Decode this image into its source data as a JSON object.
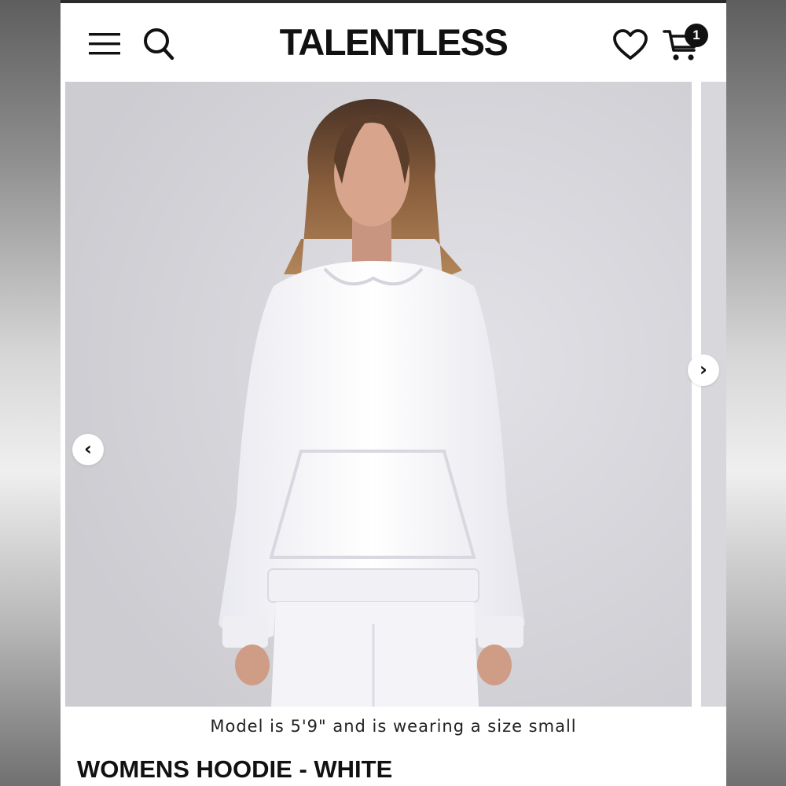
{
  "header": {
    "brand": "TALENTLESS",
    "menu_icon": "hamburger-menu-icon",
    "search_icon": "search-icon",
    "wishlist_icon": "heart-icon",
    "cart_icon": "cart-icon",
    "cart_count": "1"
  },
  "gallery": {
    "prev_symbol": "‹",
    "next_symbol": "›",
    "zoom_icon": "magnifier-icon",
    "image_subject": "model wearing white hoodie"
  },
  "product": {
    "model_caption": "Model is 5'9\" and is wearing a size small",
    "title": "WOMENS HOODIE - WHITE"
  },
  "colors": {
    "brand_text": "#111111",
    "background": "#ffffff",
    "photo_backdrop": "#d9d8dd",
    "badge": "#111111"
  }
}
